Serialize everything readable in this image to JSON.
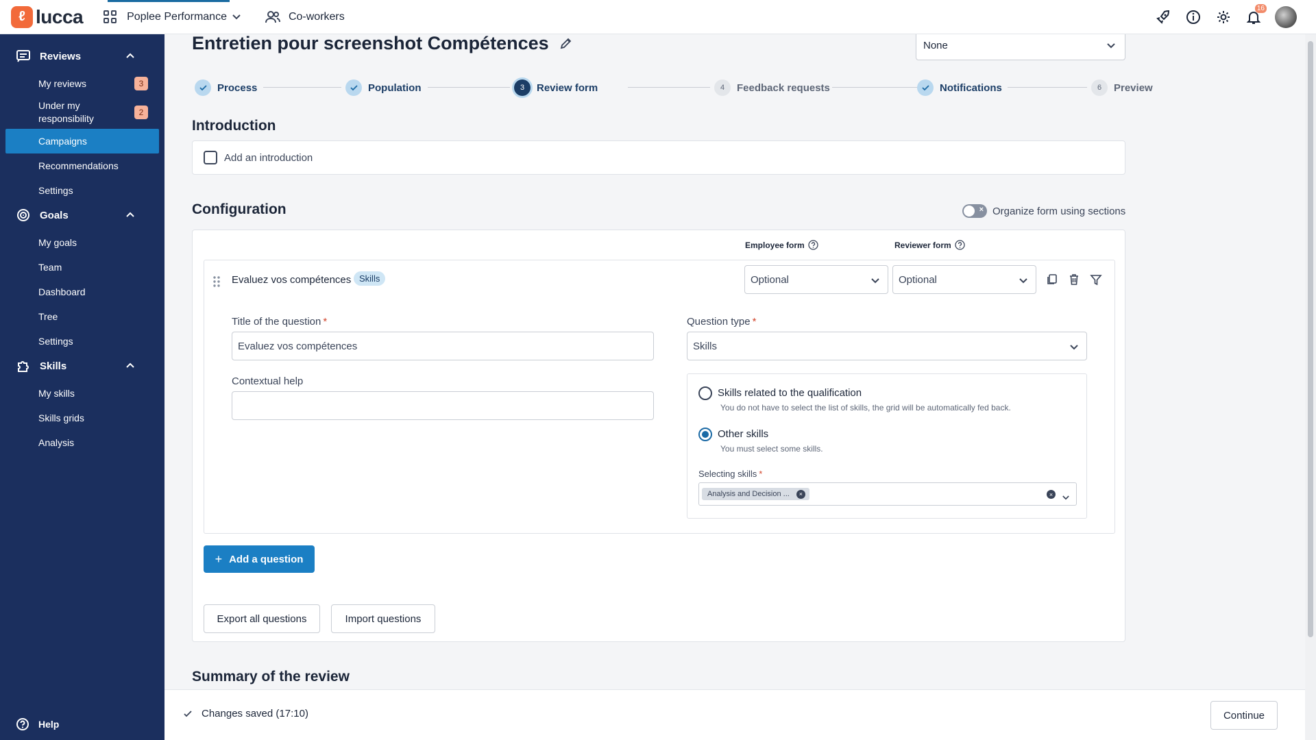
{
  "topbar": {
    "logo_text": "lucca",
    "app_name": "Poplee Performance",
    "coworkers": "Co-workers",
    "notifications_count": "16"
  },
  "sidebar": {
    "sections": [
      {
        "label": "Reviews",
        "items": [
          {
            "label": "My reviews",
            "badge": "3"
          },
          {
            "label": "Under my responsibility",
            "badge": "2"
          },
          {
            "label": "Campaigns",
            "active": true
          },
          {
            "label": "Recommendations"
          },
          {
            "label": "Settings"
          }
        ]
      },
      {
        "label": "Goals",
        "items": [
          {
            "label": "My goals"
          },
          {
            "label": "Team"
          },
          {
            "label": "Dashboard"
          },
          {
            "label": "Tree"
          },
          {
            "label": "Settings"
          }
        ]
      },
      {
        "label": "Skills",
        "items": [
          {
            "label": "My skills"
          },
          {
            "label": "Skills grids"
          },
          {
            "label": "Analysis"
          }
        ]
      }
    ],
    "help": "Help"
  },
  "page": {
    "title": "Entretien pour screenshot Compétences",
    "top_select_value": "None"
  },
  "steps": [
    {
      "label": "Process",
      "state": "done"
    },
    {
      "label": "Population",
      "state": "done"
    },
    {
      "number": "3",
      "label": "Review form",
      "state": "current"
    },
    {
      "number": "4",
      "label": "Feedback requests",
      "state": "todo"
    },
    {
      "label": "Notifications",
      "state": "done"
    },
    {
      "number": "6",
      "label": "Preview",
      "state": "todo"
    }
  ],
  "introduction": {
    "heading": "Introduction",
    "checkbox_label": "Add an introduction"
  },
  "configuration": {
    "heading": "Configuration",
    "organize_toggle_label": "Organize form using sections",
    "employee_form_label": "Employee form",
    "reviewer_form_label": "Reviewer form",
    "question": {
      "title": "Evaluez vos compétences",
      "tag": "Skills",
      "employee_form_value": "Optional",
      "reviewer_form_value": "Optional",
      "title_label": "Title of the question",
      "title_value": "Evaluez vos compétences",
      "contextual_help_label": "Contextual help",
      "contextual_help_value": "",
      "question_type_label": "Question type",
      "question_type_value": "Skills",
      "options": [
        {
          "label": "Skills related to the qualification",
          "help": "You do not have to select the list of skills, the grid will be automatically fed back.",
          "checked": false
        },
        {
          "label": "Other skills",
          "help": "You must select some skills.",
          "checked": true
        }
      ],
      "selecting_skills_label": "Selecting skills",
      "selected_skill_chip": "Analysis and Decision ..."
    },
    "add_question": "Add a question",
    "export_all": "Export all questions",
    "import": "Import questions"
  },
  "summary": {
    "heading": "Summary of the review"
  },
  "footer": {
    "saved_status": "Changes saved (17:10)",
    "continue": "Continue"
  },
  "colors": {
    "sidebar_bg": "#1b2f5e",
    "primary": "#1b7fc4",
    "logo": "#f26a3a",
    "badge": "#f7b29a"
  }
}
